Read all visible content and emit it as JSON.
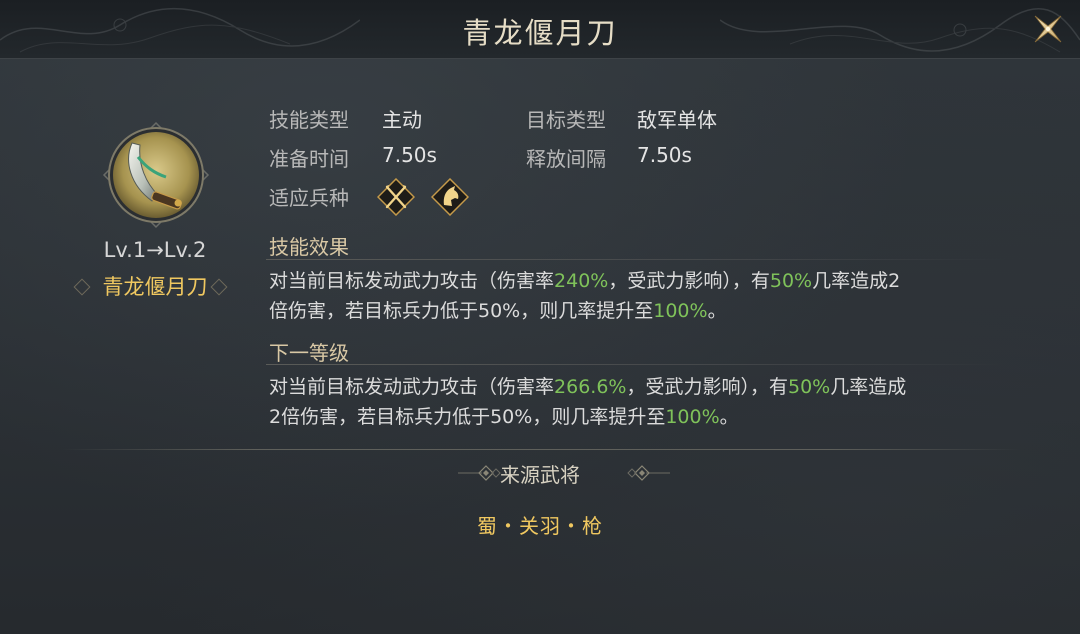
{
  "header": {
    "title": "青龙偃月刀"
  },
  "skill": {
    "level_text": "Lv.1→Lv.2",
    "name": "青龙偃月刀"
  },
  "info": {
    "skill_type_label": "技能类型",
    "skill_type_value": "主动",
    "target_type_label": "目标类型",
    "target_type_value": "敌军单体",
    "prep_time_label": "准备时间",
    "prep_time_value": "7.50s",
    "release_interval_label": "释放间隔",
    "release_interval_value": "7.50s",
    "troop_label": "适应兵种",
    "troop_icons": [
      "crossed-spears-icon",
      "horse-head-icon"
    ]
  },
  "effect": {
    "title": "技能效果",
    "line1": [
      {
        "t": "对当前目标发动武力攻击（伤害率",
        "c": "normal"
      },
      {
        "t": "240%",
        "c": "green"
      },
      {
        "t": "，受武力影响），有",
        "c": "normal"
      },
      {
        "t": "50%",
        "c": "green"
      },
      {
        "t": "几率造成2",
        "c": "normal"
      }
    ],
    "line2": [
      {
        "t": "倍伤害，若目标兵力低于50%，则几率提升至",
        "c": "normal"
      },
      {
        "t": "100%",
        "c": "green"
      },
      {
        "t": "。",
        "c": "normal"
      }
    ]
  },
  "next_level": {
    "title": "下一等级",
    "line1": [
      {
        "t": "对当前目标发动武力攻击（伤害率",
        "c": "normal"
      },
      {
        "t": "266.6%",
        "c": "green"
      },
      {
        "t": "，受武力影响），有",
        "c": "normal"
      },
      {
        "t": "50%",
        "c": "green"
      },
      {
        "t": "几率造成",
        "c": "normal"
      }
    ],
    "line2": [
      {
        "t": "2倍伤害，若目标兵力低于50%，则几率提升至",
        "c": "normal"
      },
      {
        "t": "100%",
        "c": "green"
      },
      {
        "t": "。",
        "c": "normal"
      }
    ]
  },
  "source": {
    "title": "来源武将",
    "general": "蜀・关羽・枪"
  },
  "colors": {
    "accent_gold": "#f0c860",
    "highlight_green": "#7fc25a",
    "title_text": "#e6ddc6"
  }
}
